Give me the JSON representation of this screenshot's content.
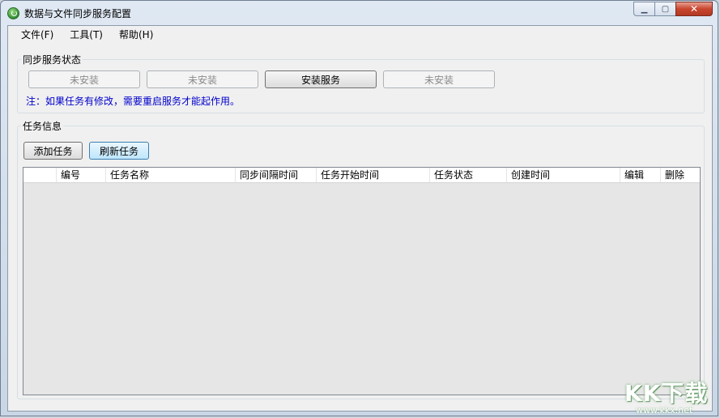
{
  "window": {
    "title": "数据与文件同步服务配置"
  },
  "menu": [
    "文件(F)",
    "工具(T)",
    "帮助(H)"
  ],
  "service_group": {
    "label": "同步服务状态",
    "buttons": [
      "未安装",
      "未安装",
      "安装服务",
      "未安装"
    ],
    "note": "注：如果任务有修改，需要重启服务才能起作用。"
  },
  "task_group": {
    "label": "任务信息",
    "add_button": "添加任务",
    "refresh_button": "刷新任务",
    "columns": [
      "",
      "编号",
      "任务名称",
      "同步间隔时间",
      "任务开始时间",
      "任务状态",
      "创建时间",
      "编辑",
      "删除"
    ]
  },
  "watermark": {
    "main": "KK下载",
    "sub": "www.kkx.net"
  }
}
